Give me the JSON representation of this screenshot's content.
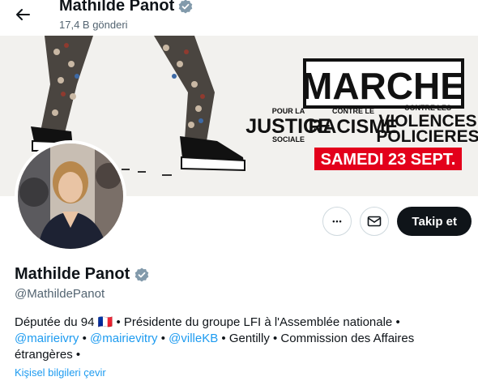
{
  "header": {
    "name": "Mathilde Panot",
    "post_count": "17,4 B gönderi"
  },
  "banner": {
    "headline": "MARCHE",
    "line1_small": "POUR LA",
    "line1_big": "JUSTICE",
    "line1_sub": "SOCIALE",
    "line2_small": "CONTRE LE",
    "line2_big": "RACISME",
    "line3_small": "CONTRE LES",
    "line3_big1": "VIOLENCES",
    "line3_big2": "POLICIERES",
    "date": "SAMEDI 23 SEPT."
  },
  "actions": {
    "more_label": "•••",
    "follow_label": "Takip et"
  },
  "profile": {
    "name": "Mathilde Panot",
    "handle": "@MathildePanot",
    "bio_1": "Députée du 94 ",
    "flag": "🇫🇷",
    "bio_2": " • Présidente du groupe LFI à l'Assemblée nationale •",
    "mention_1": "@mairieivry",
    "sep_1": " • ",
    "mention_2": "@mairievitry",
    "sep_2": " • ",
    "mention_3": "@villeKB",
    "bio_3": " • Gentilly • Commission des Affaires étrangères •",
    "translate_label": "Kişisel bilgileri çevir"
  },
  "colors": {
    "accent": "#1d9bf0",
    "follow_bg": "#0f1419",
    "banner_red": "#e3001b",
    "verified": "#829aab"
  },
  "icons": [
    "back-arrow-icon",
    "verified-badge-icon",
    "more-icon",
    "mail-icon"
  ]
}
